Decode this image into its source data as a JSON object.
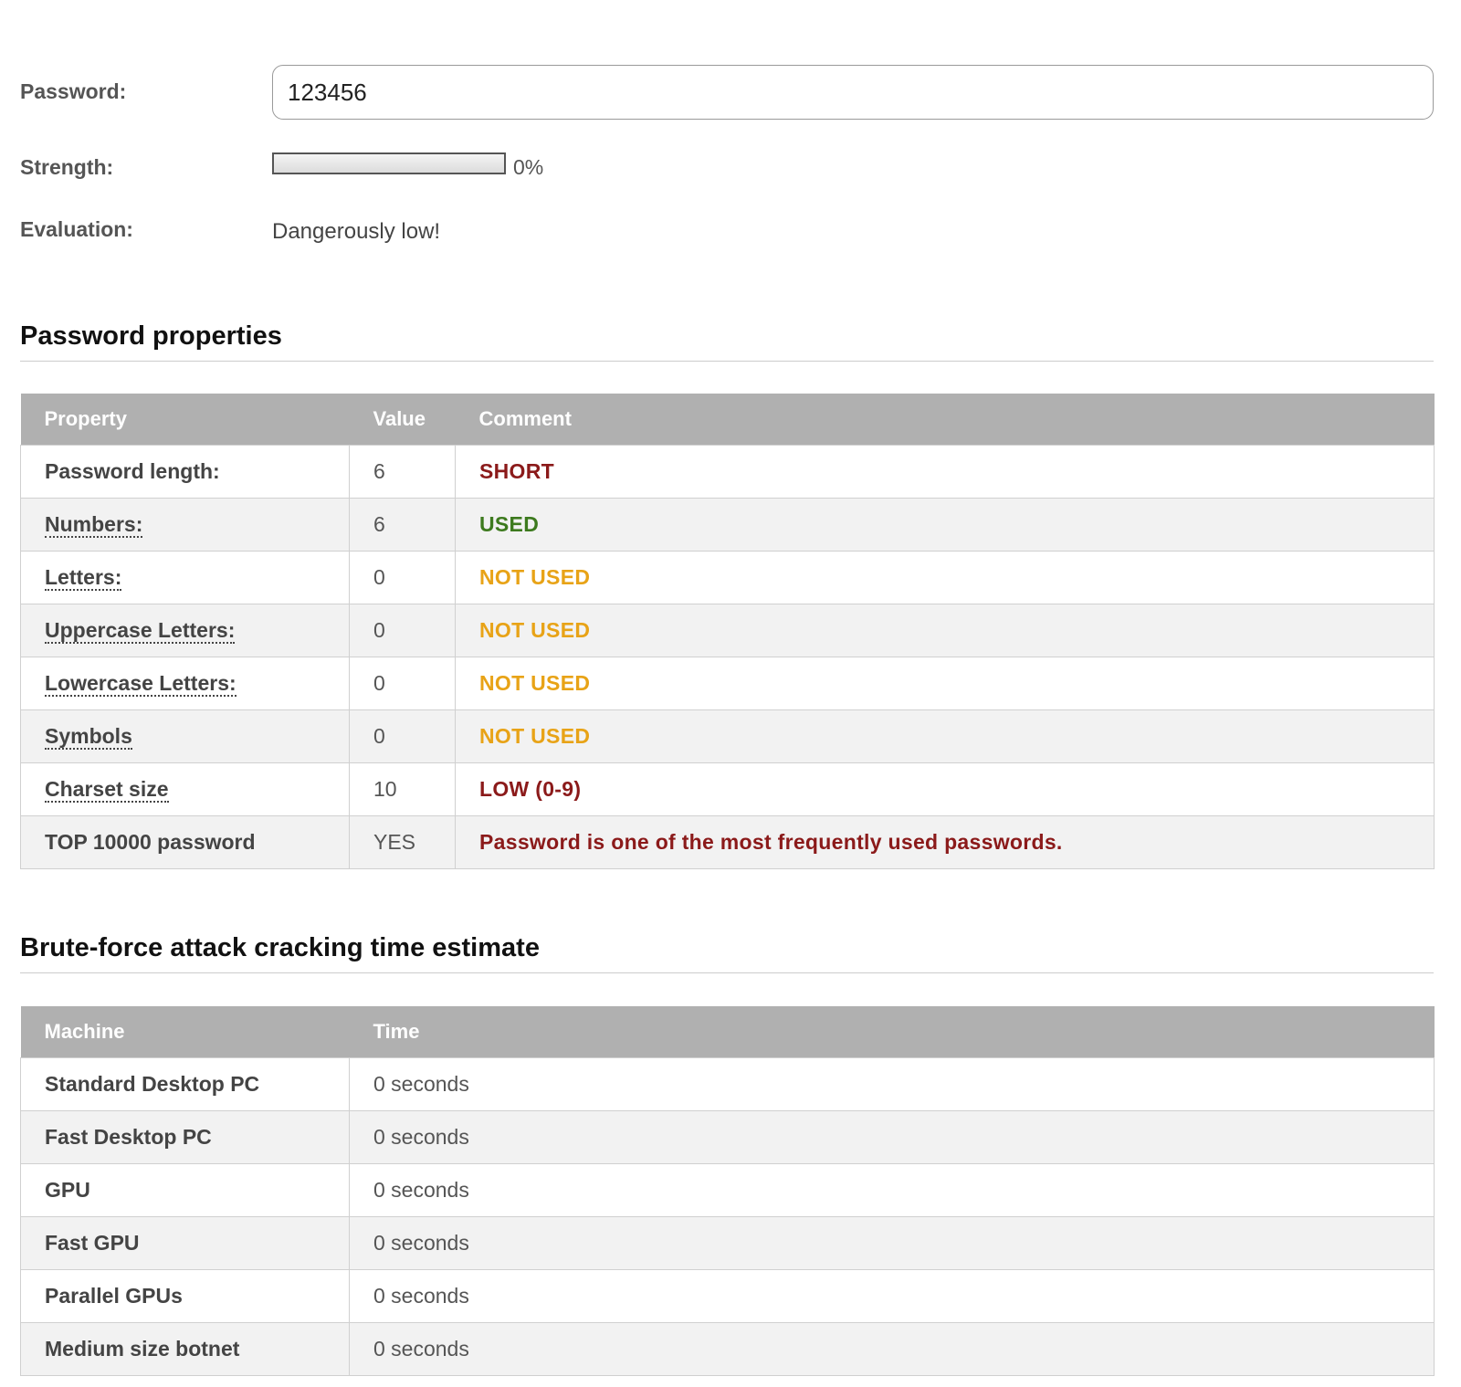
{
  "form": {
    "password_label": "Password:",
    "password_value": "123456",
    "strength_label": "Strength:",
    "strength_percent_text": "0%",
    "strength_fraction": 0,
    "evaluation_label": "Evaluation:",
    "evaluation_text": "Dangerously low!"
  },
  "properties": {
    "title": "Password properties",
    "headers": [
      "Property",
      "Value",
      "Comment"
    ],
    "rows": [
      {
        "property": "Password length:",
        "value": "6",
        "comment": "SHORT",
        "comment_color": "#8b1a1a",
        "dotted": false
      },
      {
        "property": "Numbers:",
        "value": "6",
        "comment": "USED",
        "comment_color": "#3d7a1e",
        "dotted": true
      },
      {
        "property": "Letters:",
        "value": "0",
        "comment": "NOT USED",
        "comment_color": "#e8a317",
        "dotted": true
      },
      {
        "property": "Uppercase Letters:",
        "value": "0",
        "comment": "NOT USED",
        "comment_color": "#e8a317",
        "dotted": true
      },
      {
        "property": "Lowercase Letters:",
        "value": "0",
        "comment": "NOT USED",
        "comment_color": "#e8a317",
        "dotted": true
      },
      {
        "property": "Symbols",
        "value": "0",
        "comment": "NOT USED",
        "comment_color": "#e8a317",
        "dotted": true
      },
      {
        "property": "Charset size",
        "value": "10",
        "comment": "LOW (0-9)",
        "comment_color": "#8b1a1a",
        "dotted": true
      },
      {
        "property": "TOP 10000 password",
        "value": "YES",
        "comment": "Password is one of the most frequently used passwords.",
        "comment_color": "#8b1a1a",
        "dotted": false
      }
    ]
  },
  "bruteforce": {
    "title": "Brute-force attack cracking time estimate",
    "headers": [
      "Machine",
      "Time"
    ],
    "rows": [
      {
        "machine": "Standard Desktop PC",
        "time": "0 seconds"
      },
      {
        "machine": "Fast Desktop PC",
        "time": "0 seconds"
      },
      {
        "machine": "GPU",
        "time": "0 seconds"
      },
      {
        "machine": "Fast GPU",
        "time": "0 seconds"
      },
      {
        "machine": "Parallel GPUs",
        "time": "0 seconds"
      },
      {
        "machine": "Medium size botnet",
        "time": "0 seconds"
      }
    ]
  }
}
